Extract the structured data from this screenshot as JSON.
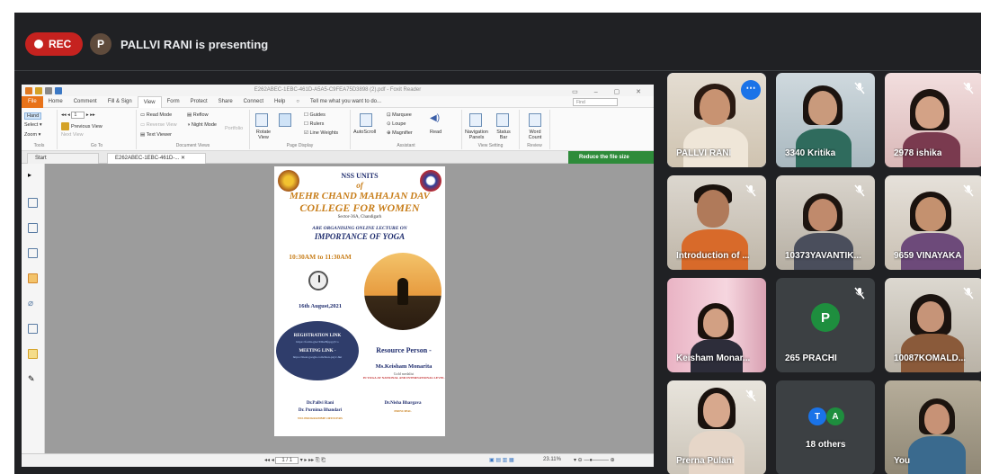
{
  "meet": {
    "rec_label": "REC",
    "presenter_initial": "P",
    "presenter_text": "PALLVI RANI is presenting"
  },
  "reader": {
    "window_title": "E262ABEC-1EBC-461D-A5A5-C9FEA75D3898 (2).pdf - Foxit Reader",
    "tabs": [
      "File",
      "Home",
      "Comment",
      "Fill & Sign",
      "View",
      "Form",
      "Protect",
      "Share",
      "Connect",
      "Help"
    ],
    "tell_me": "Tell me what you want to do...",
    "find_placeholder": "Find",
    "ribbon": {
      "hand": "Hand",
      "select": "Select",
      "zoom": "Zoom",
      "tools_cap": "Tools",
      "page_num": "1",
      "previous_view": "Previous View",
      "next_view": "Next View",
      "goto_cap": "Go To",
      "read_mode": "Read Mode",
      "reverse_view": "Reverse View",
      "text_viewer": "Text Viewer",
      "reflow": "Reflow",
      "night_mode": "Night Mode",
      "portfolio": "Portfolio",
      "docviews_cap": "Document Views",
      "rotate_view": "Rotate View",
      "guides": "Guides",
      "rulers": "Rulers",
      "line_weights": "Line Weights",
      "pagedisplay_cap": "Page Display",
      "autoscroll": "AutoScroll",
      "marquee": "Marquee",
      "loupe": "Loupe",
      "magnifier": "Magnifier",
      "read": "Read",
      "assistant_cap": "Assistant",
      "nav_panels": "Navigation Panels",
      "status_bar": "Status Bar",
      "viewsetting_cap": "View Setting",
      "word_count": "Word Count",
      "review_cap": "Review"
    },
    "doc_tabs": [
      "Start",
      "E262ABEC-1EBC-461D-..."
    ],
    "reduce_label": "Reduce the file size",
    "page_indicator": "1 / 1",
    "zoom_level": "23.11%"
  },
  "poster": {
    "line1": "NSS UNITS",
    "line2": "of",
    "line3": "MEHR CHAND MAHAJAN DAV",
    "line4": "COLLEGE FOR WOMEN",
    "line5": "Sector-36A, Chandigarh",
    "line6": "ARE ORGANISING ONLINE LECTURE ON",
    "line7": "IMPORTANCE OF YOGA",
    "time": "10:30AM to 11:30AM",
    "date": "16th August,2021",
    "reg_title": "REGISTRATION LINK",
    "reg_link": "https://forms.gle/cDKz8fppgq7co",
    "meet_title": "MEETING LINK -",
    "meet_link": "https://meet.google.com/mon-psyv-hkt",
    "rp_title": "Resource Person -",
    "rp_name": "Ms.Keisham Monarita",
    "rp_sub": "Gold medalist",
    "rp_sub2": "IN YOGA AT NATIONAL AND INTERNATIONAL LEVEL",
    "sig1_a": "Dr.Pallvi Rani",
    "sig1_b": "Dr. Purnima Bhandari",
    "sig1_c": "NSS PROGRAMME OFFICERS",
    "sig2_a": "Dr.Nisha Bhargava",
    "sig2_b": "PRINCIPAL"
  },
  "participants": [
    {
      "name": "PALLVI RANI"
    },
    {
      "name": "3340 Kritika"
    },
    {
      "name": "2978 ishika"
    },
    {
      "name": "Introduction of ..."
    },
    {
      "name": "10373YAVANTIK..."
    },
    {
      "name": "9659 VINAYAKA"
    },
    {
      "name": "Keisham Monar..."
    },
    {
      "name": "265 PRACHI",
      "initial": "P"
    },
    {
      "name": "10087KOMALD..."
    },
    {
      "name": "Prerna Pulani"
    },
    {
      "name": "18 others",
      "initials": [
        "T",
        "A"
      ]
    },
    {
      "name": "You"
    }
  ],
  "colors": {
    "rec": "#c5221f",
    "tile_bg": "#3c4043",
    "meet_bg": "#202124",
    "avatar_green": "#1e8e3e",
    "avatar_blue": "#1a73e8"
  }
}
